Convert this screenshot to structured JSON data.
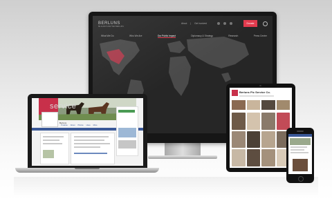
{
  "monitor": {
    "brand": "BERLUNS",
    "brand_sub": "BE ALWAYS BETTER BERLUNS",
    "top_menu": [
      "About",
      "Get Involved"
    ],
    "donate_label": "Donate",
    "nav": [
      "What We Do",
      "Who We Are",
      "Our Public Impact",
      "Diplomacy & Strategy",
      "Research",
      "Press Center"
    ],
    "active_nav_index": 2,
    "hero_text": "service"
  },
  "laptop": {
    "page_name": "Berluns",
    "tabs": [
      "Timeline",
      "About",
      "Photos",
      "Likes",
      "More"
    ]
  },
  "tablet": {
    "title": "Berluns Pic Service Co."
  },
  "colors": {
    "accent": "#e23b4e",
    "facebook_blue": "#3b5998"
  }
}
